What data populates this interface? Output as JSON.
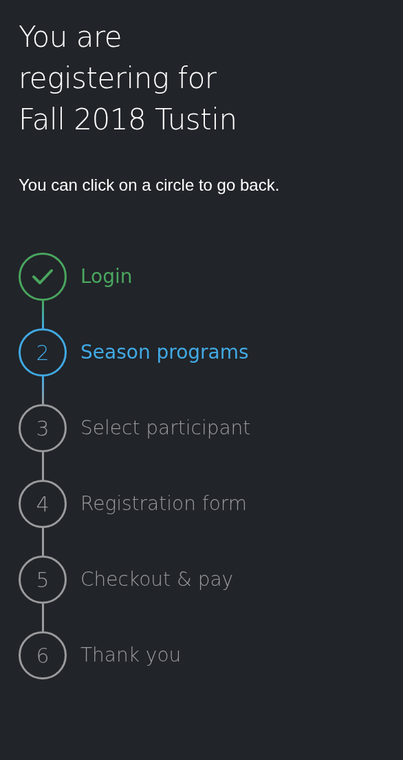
{
  "title": "You are registering for Fall 2018 Tustin",
  "hint": "You can click on a circle to go back.",
  "steps": [
    {
      "label": "Login",
      "done": true,
      "selected": false
    },
    {
      "number": "2",
      "label": "Season programs",
      "done": false,
      "selected": true
    },
    {
      "number": "3",
      "label": "Select participant",
      "done": false,
      "selected": false
    },
    {
      "number": "4",
      "label": "Registration form",
      "done": false,
      "selected": false
    },
    {
      "number": "5",
      "label": "Checkout & pay",
      "done": false,
      "selected": false
    },
    {
      "number": "6",
      "label": "Thank you",
      "done": false,
      "selected": false
    }
  ]
}
